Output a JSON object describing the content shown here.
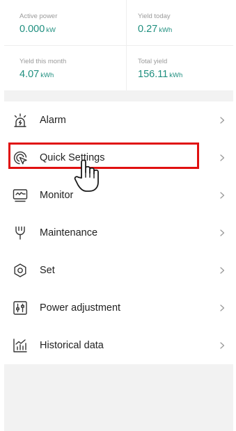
{
  "stats": {
    "active_power": {
      "label": "Active power",
      "value": "0.000",
      "unit": "kW"
    },
    "yield_today": {
      "label": "Yield today",
      "value": "0.27",
      "unit": "kWh"
    },
    "yield_month": {
      "label": "Yield this month",
      "value": "4.07",
      "unit": "kWh"
    },
    "total_yield": {
      "label": "Total yield",
      "value": "156.11",
      "unit": "kWh"
    }
  },
  "menu": {
    "items": [
      {
        "label": "Alarm",
        "icon": "alarm-icon"
      },
      {
        "label": "Quick Settings",
        "icon": "quick-settings-icon"
      },
      {
        "label": "Monitor",
        "icon": "monitor-icon"
      },
      {
        "label": "Maintenance",
        "icon": "maintenance-icon"
      },
      {
        "label": "Set",
        "icon": "settings-icon"
      },
      {
        "label": "Power adjustment",
        "icon": "power-adjustment-icon"
      },
      {
        "label": "Historical data",
        "icon": "historical-data-icon"
      }
    ]
  },
  "colors": {
    "accent": "#1f8f7f",
    "highlight": "#e01010"
  }
}
